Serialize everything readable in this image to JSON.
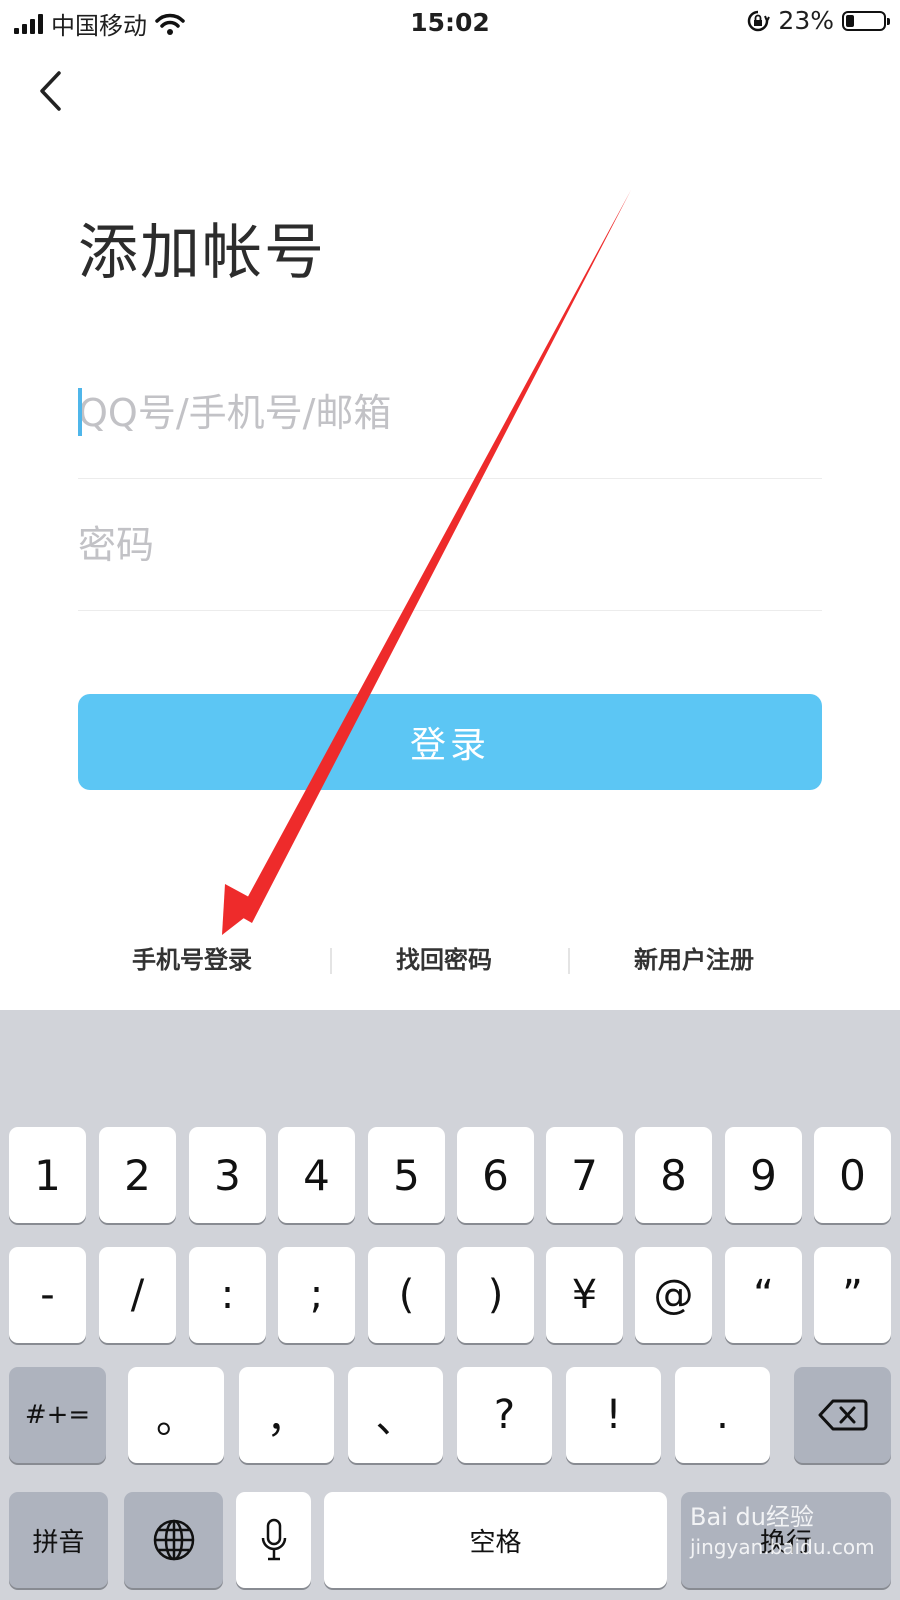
{
  "status_bar": {
    "carrier": "中国移动",
    "time": "15:02",
    "battery": "23%"
  },
  "page": {
    "title": "添加帐号"
  },
  "form": {
    "account_placeholder": "QQ号/手机号/邮箱",
    "password_placeholder": "密码",
    "login_label": "登录"
  },
  "links": {
    "phone_login": "手机号登录",
    "recover_password": "找回密码",
    "register": "新用户注册"
  },
  "keyboard": {
    "row1": [
      "1",
      "2",
      "3",
      "4",
      "5",
      "6",
      "7",
      "8",
      "9",
      "0"
    ],
    "row2": [
      "-",
      "/",
      ":",
      ";",
      "(",
      ")",
      "¥",
      "@",
      "“",
      "”"
    ],
    "row3": {
      "symbols_label": "#+=",
      "keys": [
        "。",
        "，",
        "、",
        "?",
        "!",
        "."
      ]
    },
    "row4": {
      "pinyin_label": "拼音",
      "space_label": "空格",
      "return_label": "换行"
    }
  },
  "watermark": {
    "brand": "Bai du经验",
    "url": "jingyan.baidu.com"
  },
  "colors": {
    "accent": "#5cc6f4",
    "annotation_arrow": "#ee2b2b",
    "keyboard_bg": "#d1d3d9"
  }
}
